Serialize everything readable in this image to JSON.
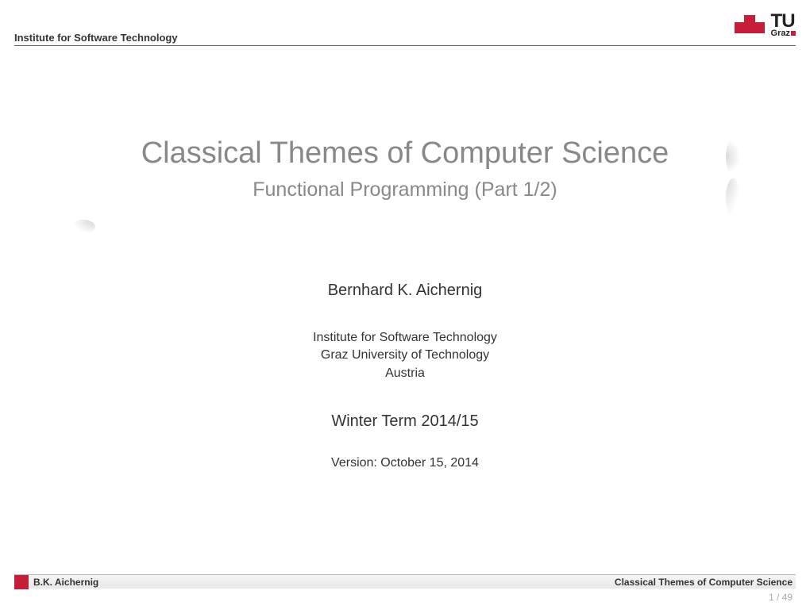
{
  "header": {
    "institute": "Institute for Software Technology",
    "logo_tu": "TU",
    "logo_graz": "Graz"
  },
  "title": {
    "main": "Classical Themes of Computer Science",
    "sub": "Functional Programming (Part 1/2)"
  },
  "author": "Bernhard K. Aichernig",
  "affiliation": {
    "line1": "Institute for Software Technology",
    "line2": "Graz University of Technology",
    "line3": "Austria"
  },
  "term": "Winter Term 2014/15",
  "version": "Version: October 15, 2014",
  "footer": {
    "author_short": "B.K. Aichernig",
    "title_short": "Classical Themes of Computer Science",
    "page": "1 / 49"
  }
}
